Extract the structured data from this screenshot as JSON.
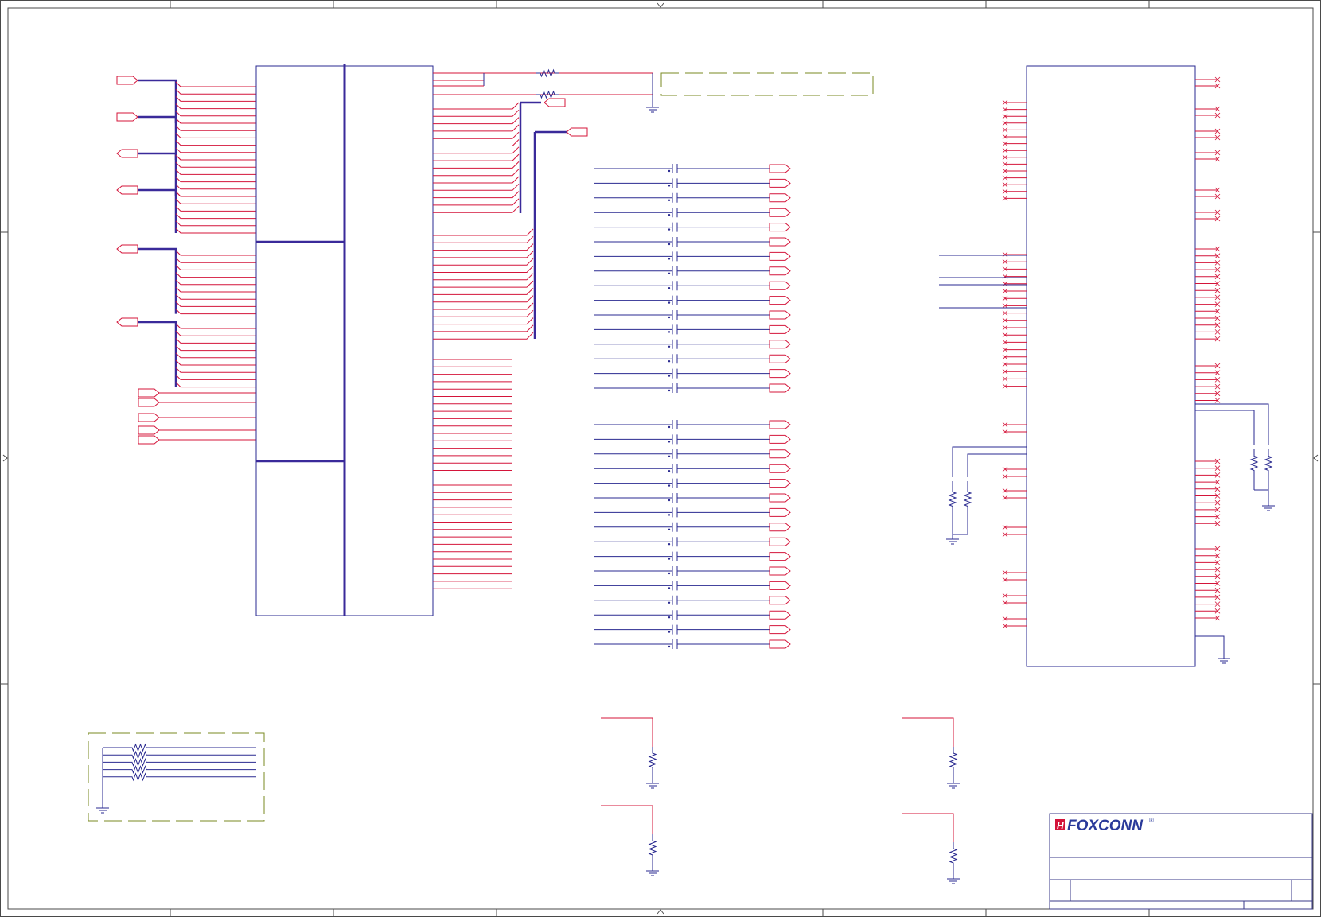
{
  "title_block": {
    "company": "FOXCONN",
    "registered_mark": "®"
  },
  "colors": {
    "wire": "#d4143a",
    "bus": "#3a2a9a",
    "component": "#2a2a90",
    "frame": "#4a4a4a",
    "note_border": "#7a8a20",
    "logo_blue": "#2a3a9a",
    "logo_red": "#d4143a"
  },
  "icons": {
    "hierarchical_port": "pentagon-port-icon",
    "ground": "ground-symbol-icon",
    "resistor": "resistor-zigzag-icon",
    "capacitor": "capacitor-plates-icon",
    "no_connect": "no-connect-x-icon"
  }
}
